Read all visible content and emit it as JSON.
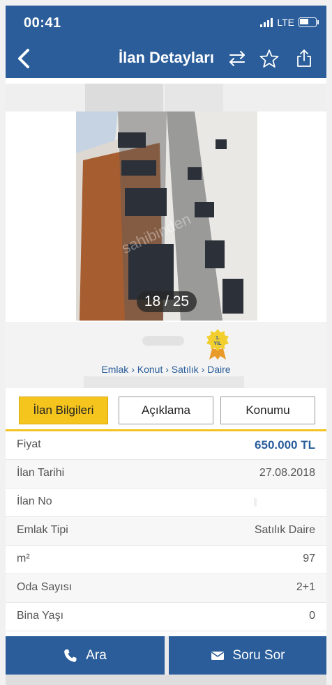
{
  "status_bar": {
    "time": "00:41",
    "network": "LTE"
  },
  "nav": {
    "title": "İlan Detayları"
  },
  "gallery": {
    "counter": "18 / 25"
  },
  "badge": {
    "text": "1. YIL"
  },
  "breadcrumb": "Emlak › Konut › Satılık › Daire",
  "tabs": [
    {
      "label": "İlan Bilgileri",
      "active": true
    },
    {
      "label": "Açıklama",
      "active": false
    },
    {
      "label": "Konumu",
      "active": false
    }
  ],
  "details": [
    {
      "label": "Fiyat",
      "value": "650.000 TL"
    },
    {
      "label": "İlan Tarihi",
      "value": "27.08.2018"
    },
    {
      "label": "İlan No",
      "value": ""
    },
    {
      "label": "Emlak Tipi",
      "value": "Satılık Daire"
    },
    {
      "label": "m²",
      "value": "97"
    },
    {
      "label": "Oda Sayısı",
      "value": "2+1"
    },
    {
      "label": "Bina Yaşı",
      "value": "0"
    }
  ],
  "actions": {
    "call_label": "Ara",
    "ask_label": "Soru Sor"
  },
  "colors": {
    "primary": "#2a5d9a",
    "accent": "#f5c51e"
  }
}
